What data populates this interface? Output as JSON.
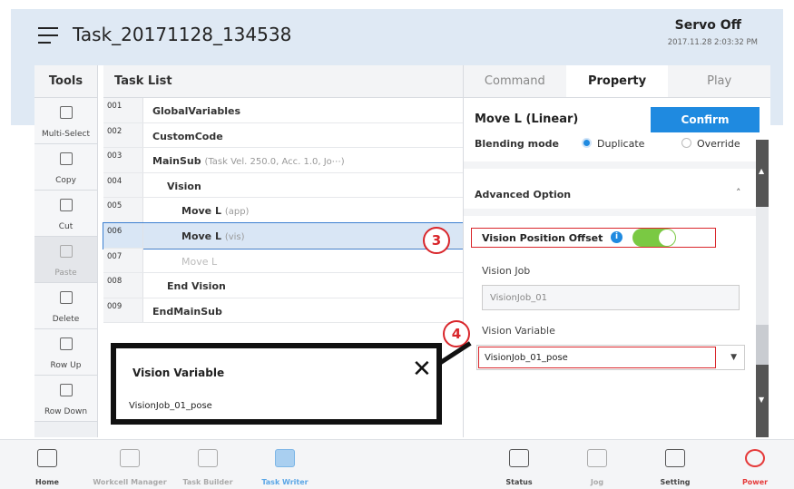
{
  "header": {
    "title": "Task_20171128_134538",
    "servo_status": "Servo Off",
    "datetime": "2017.11.28 2:03:32 PM"
  },
  "tools": {
    "heading": "Tools",
    "items": [
      {
        "label": "Multi-Select",
        "icon": "multi-select-icon"
      },
      {
        "label": "Copy",
        "icon": "copy-icon"
      },
      {
        "label": "Cut",
        "icon": "cut-icon"
      },
      {
        "label": "Paste",
        "icon": "paste-icon"
      },
      {
        "label": "Delete",
        "icon": "delete-icon"
      },
      {
        "label": "Row Up",
        "icon": "row-up-icon"
      },
      {
        "label": "Row Down",
        "icon": "row-down-icon"
      }
    ]
  },
  "task_list": {
    "heading": "Task List",
    "rows": [
      {
        "num": "001",
        "text": "GlobalVariables",
        "param": ""
      },
      {
        "num": "002",
        "text": "CustomCode",
        "param": ""
      },
      {
        "num": "003",
        "text": "MainSub",
        "param": "(Task Vel. 250.0, Acc. 1.0, Jo⋯)"
      },
      {
        "num": "004",
        "text": "Vision",
        "param": ""
      },
      {
        "num": "005",
        "text": "Move L",
        "param": "(app)"
      },
      {
        "num": "006",
        "text": "Move L",
        "param": "(vis)"
      },
      {
        "num": "007",
        "text": "Move L",
        "param": ""
      },
      {
        "num": "008",
        "text": "End Vision",
        "param": ""
      },
      {
        "num": "009",
        "text": "EndMainSub",
        "param": ""
      }
    ]
  },
  "right_panel": {
    "tabs": [
      "Command",
      "Property",
      "Play"
    ],
    "active_tab": "Property",
    "prop_title": "Move L (Linear)",
    "confirm_label": "Confirm",
    "blending_label": "Blending mode",
    "blending_options": [
      "Duplicate",
      "Override"
    ],
    "blending_selected": "Duplicate",
    "advanced_label": "Advanced Option",
    "advanced_chevron": "˄",
    "vpo_label": "Vision Position Offset",
    "vpo_info": "i",
    "vpo_enabled": true,
    "vision_job_label": "Vision Job",
    "vision_job_value": "VisionJob_01",
    "vision_variable_label": "Vision Variable",
    "vision_variable_value": "VisionJob_01_pose",
    "select_arrow": "▼",
    "scroll_up": "▲",
    "scroll_down": "▼"
  },
  "callouts": {
    "three": "3",
    "four": "4"
  },
  "popup": {
    "title": "Vision Variable",
    "value": "VisionJob_01_pose",
    "close": "✕"
  },
  "bottom_nav": [
    {
      "label": "Home",
      "icon": "home-icon"
    },
    {
      "label": "Workcell Manager",
      "icon": "workcell-manager-icon"
    },
    {
      "label": "Task Builder",
      "icon": "task-builder-icon"
    },
    {
      "label": "Task Writer",
      "icon": "task-writer-icon"
    },
    {
      "label": "Status",
      "icon": "status-icon"
    },
    {
      "label": "Jog",
      "icon": "jog-icon"
    },
    {
      "label": "Setting",
      "icon": "gear-icon"
    },
    {
      "label": "Power",
      "icon": "power-icon"
    }
  ],
  "colors": {
    "accent": "#1f8ae0",
    "highlight_red": "#d9262b",
    "toggle_on": "#7ac943",
    "power_red": "#e53a3a",
    "header_band": "#dfe9f4"
  }
}
